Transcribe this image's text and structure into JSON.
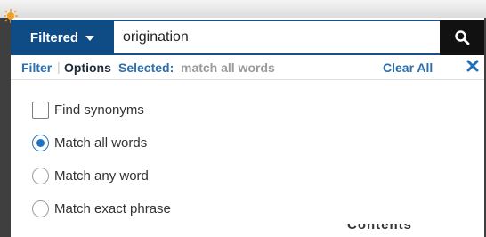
{
  "search": {
    "filter_button_label": "Filtered",
    "query_value": "origination"
  },
  "options_header": {
    "filter_tab": "Filter",
    "separator": "|",
    "options_tab": "Options",
    "selected_label": "Selected:",
    "selected_value": "match all words",
    "clear_all": "Clear All"
  },
  "options": [
    {
      "type": "checkbox",
      "label": "Find synonyms",
      "checked": false
    },
    {
      "type": "radio",
      "label": "Match all words",
      "checked": true
    },
    {
      "type": "radio",
      "label": "Match any word",
      "checked": false
    },
    {
      "type": "radio",
      "label": "Match exact phrase",
      "checked": false
    }
  ],
  "background": {
    "partial_text": "Contents"
  },
  "colors": {
    "accent": "#2a6fb0",
    "search_bar": "#0f4c86",
    "search_button": "#111111"
  }
}
